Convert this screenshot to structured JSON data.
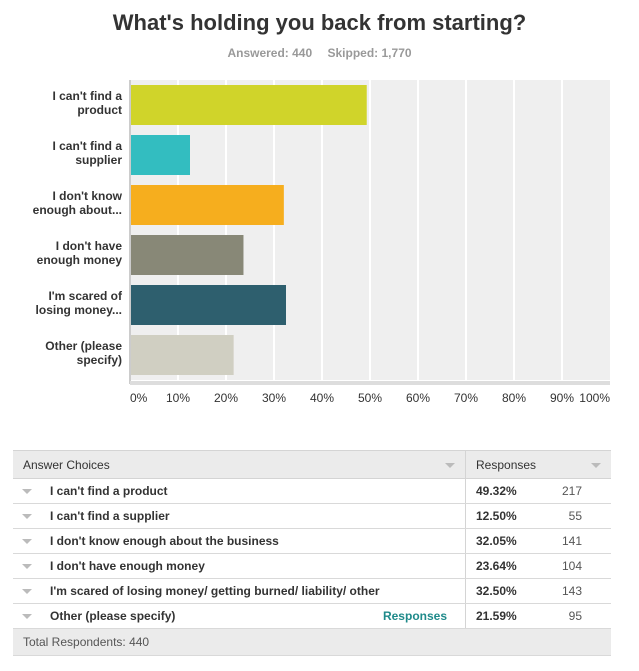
{
  "header": {
    "title": "What's holding you back from starting?",
    "answered": "Answered: 440",
    "skipped": "Skipped: 1,770"
  },
  "chart_data": {
    "type": "bar",
    "orientation": "horizontal",
    "title": "What's holding you back from starting?",
    "categories": [
      [
        "I can't find a",
        "product"
      ],
      [
        "I can't find a",
        "supplier"
      ],
      [
        "I don't know",
        "enough about..."
      ],
      [
        "I don't have",
        "enough money"
      ],
      [
        "I'm scared of",
        "losing money..."
      ],
      [
        "Other (please",
        "specify)"
      ]
    ],
    "values": [
      49.32,
      12.5,
      32.05,
      23.64,
      32.5,
      21.59
    ],
    "colors": [
      "#d0d42a",
      "#33bdc0",
      "#f6ae1e",
      "#888877",
      "#2e5f6e",
      "#d0cfc2"
    ],
    "xlabel": "",
    "ylabel": "",
    "xlim": [
      0,
      100
    ],
    "ticks": [
      "0%",
      "10%",
      "20%",
      "30%",
      "40%",
      "50%",
      "60%",
      "70%",
      "80%",
      "90%",
      "100%"
    ],
    "grid": true,
    "plot_background": "#efefef"
  },
  "table": {
    "col_answer": "Answer Choices",
    "col_responses": "Responses",
    "rows": [
      {
        "choice": "I can't find a product",
        "pct": "49.32%",
        "count": "217",
        "link": ""
      },
      {
        "choice": "I can't find a supplier",
        "pct": "12.50%",
        "count": "55",
        "link": ""
      },
      {
        "choice": "I don't know enough about the business",
        "pct": "32.05%",
        "count": "141",
        "link": ""
      },
      {
        "choice": "I don't have enough money",
        "pct": "23.64%",
        "count": "104",
        "link": ""
      },
      {
        "choice": "I'm scared of losing money/ getting burned/ liability/ other",
        "pct": "32.50%",
        "count": "143",
        "link": ""
      },
      {
        "choice": "Other (please specify)",
        "pct": "21.59%",
        "count": "95",
        "link": "Responses"
      }
    ],
    "total": "Total Respondents: 440"
  }
}
